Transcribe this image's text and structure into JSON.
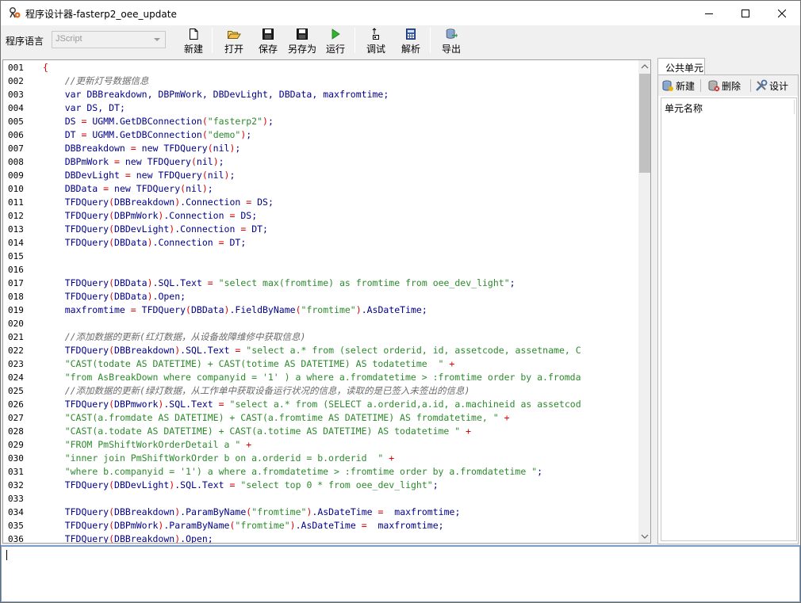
{
  "window": {
    "title": "程序设计器-fasterp2_oee_update"
  },
  "toolbar": {
    "lang_label": "程序语言",
    "lang_value": "JScript",
    "buttons": [
      {
        "label": "新建",
        "icon": "new-file-icon"
      },
      {
        "label": "打开",
        "icon": "open-folder-icon"
      },
      {
        "label": "保存",
        "icon": "save-disk-icon"
      },
      {
        "label": "另存为",
        "icon": "save-as-disk-icon"
      },
      {
        "label": "运行",
        "icon": "run-play-icon"
      },
      {
        "label": "调试",
        "icon": "debug-cursor-icon"
      },
      {
        "label": "解析",
        "icon": "calculator-icon"
      },
      {
        "label": "导出",
        "icon": "export-database-icon"
      }
    ]
  },
  "editor": {
    "lines": [
      {
        "n": "001",
        "t": "{"
      },
      {
        "n": "002",
        "t": "    //更新灯号数据信息"
      },
      {
        "n": "003",
        "t": "    var DBBreakdown, DBPmWork, DBDevLight, DBData, maxfromtime;"
      },
      {
        "n": "004",
        "t": "    var DS, DT;"
      },
      {
        "n": "005",
        "t": "    DS = UGMM.GetDBConnection(\"fasterp2\");"
      },
      {
        "n": "006",
        "t": "    DT = UGMM.GetDBConnection(\"demo\");"
      },
      {
        "n": "007",
        "t": "    DBBreakdown = new TFDQuery(nil);"
      },
      {
        "n": "008",
        "t": "    DBPmWork = new TFDQuery(nil);"
      },
      {
        "n": "009",
        "t": "    DBDevLight = new TFDQuery(nil);"
      },
      {
        "n": "010",
        "t": "    DBData = new TFDQuery(nil);"
      },
      {
        "n": "011",
        "t": "    TFDQuery(DBBreakdown).Connection = DS;"
      },
      {
        "n": "012",
        "t": "    TFDQuery(DBPmWork).Connection = DS;"
      },
      {
        "n": "013",
        "t": "    TFDQuery(DBDevLight).Connection = DT;"
      },
      {
        "n": "014",
        "t": "    TFDQuery(DBData).Connection = DT;"
      },
      {
        "n": "015",
        "t": ""
      },
      {
        "n": "016",
        "t": ""
      },
      {
        "n": "017",
        "t": "    TFDQuery(DBData).SQL.Text = \"select max(fromtime) as fromtime from oee_dev_light\";"
      },
      {
        "n": "018",
        "t": "    TFDQuery(DBData).Open;"
      },
      {
        "n": "019",
        "t": "    maxfromtime = TFDQuery(DBData).FieldByName(\"fromtime\").AsDateTime;"
      },
      {
        "n": "020",
        "t": ""
      },
      {
        "n": "021",
        "t": "    //添加数据的更新(红灯数据，从设备故障维修中获取信息)"
      },
      {
        "n": "022",
        "t": "    TFDQuery(DBBreakdown).SQL.Text = \"select a.* from (select orderid, id, assetcode, assetname, C"
      },
      {
        "n": "023",
        "t": "    \"CAST(todate AS DATETIME) + CAST(totime AS DATETIME) AS todatetime  \" +"
      },
      {
        "n": "024",
        "t": "    \"from AsBreakDown where companyid = '1' ) a where a.fromdatetime > :fromtime order by a.fromda"
      },
      {
        "n": "025",
        "t": "    //添加数据的更新(绿灯数据，从工作单中获取设备运行状况的信息，读取的是已签入未签出的信息)"
      },
      {
        "n": "026",
        "t": "    TFDQuery(DBPmwork).SQL.Text = \"select a.* from (SELECT a.orderid,a.id, a.machineid as assetcod"
      },
      {
        "n": "027",
        "t": "    \"CAST(a.fromdate AS DATETIME) + CAST(a.fromtime AS DATETIME) AS fromdatetime, \" +"
      },
      {
        "n": "028",
        "t": "    \"CAST(a.todate AS DATETIME) + CAST(a.totime AS DATETIME) AS todatetime \" +"
      },
      {
        "n": "029",
        "t": "    \"FROM PmShiftWorkOrderDetail a \" +"
      },
      {
        "n": "030",
        "t": "    \"inner join PmShiftWorkOrder b on a.orderid = b.orderid  \" +"
      },
      {
        "n": "031",
        "t": "    \"where b.companyid = '1') a where a.fromdatetime > :fromtime order by a.fromdatetime \";"
      },
      {
        "n": "032",
        "t": "    TFDQuery(DBDevLight).SQL.Text = \"select top 0 * from oee_dev_light\";"
      },
      {
        "n": "033",
        "t": ""
      },
      {
        "n": "034",
        "t": "    TFDQuery(DBBreakdown).ParamByName(\"fromtime\").AsDateTime =  maxfromtime;"
      },
      {
        "n": "035",
        "t": "    TFDQuery(DBPmWork).ParamByName(\"fromtime\").AsDateTime =  maxfromtime;"
      },
      {
        "n": "036",
        "t": "    TFDQuery(DBBreakdown).Open;"
      }
    ]
  },
  "right_panel": {
    "tab_label": "公共单元",
    "new_label": "新建",
    "delete_label": "删除",
    "design_label": "设计",
    "column_header": "单元名称"
  },
  "output": {
    "text": ""
  }
}
